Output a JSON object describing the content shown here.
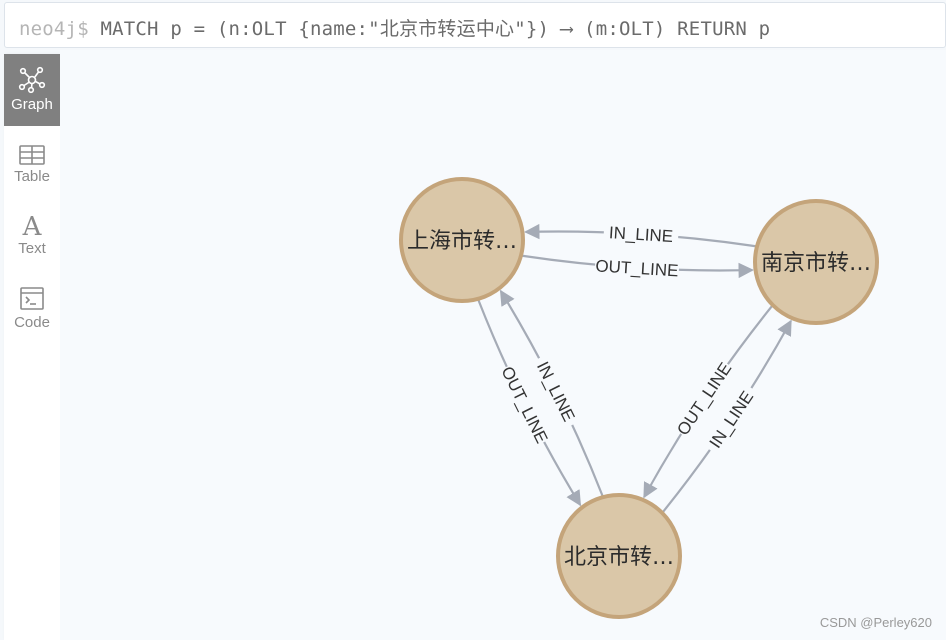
{
  "query": {
    "prompt": "neo4j$",
    "text": "MATCH p = (n:OLT {name:\"北京市转运中心\"}) ⟶ (m:OLT) RETURN p"
  },
  "sidebar": {
    "items": [
      {
        "label": "Graph",
        "icon": "graph-icon",
        "active": true
      },
      {
        "label": "Table",
        "icon": "table-icon",
        "active": false
      },
      {
        "label": "Text",
        "icon": "text-icon",
        "active": false
      },
      {
        "label": "Code",
        "icon": "code-icon",
        "active": false
      }
    ]
  },
  "graph": {
    "node_color": "#dac7a8",
    "node_border": "#c4a47a",
    "edge_color": "#a5abb6",
    "nodes": [
      {
        "id": "shanghai",
        "label": "上海市转…"
      },
      {
        "id": "nanjing",
        "label": "南京市转…"
      },
      {
        "id": "beijing",
        "label": "北京市转…"
      }
    ],
    "edges": [
      {
        "from": "shanghai",
        "to": "nanjing",
        "label": "OUT_LINE"
      },
      {
        "from": "nanjing",
        "to": "shanghai",
        "label": "IN_LINE"
      },
      {
        "from": "shanghai",
        "to": "beijing",
        "label": "OUT_LINE"
      },
      {
        "from": "beijing",
        "to": "shanghai",
        "label": "IN_LINE"
      },
      {
        "from": "beijing",
        "to": "nanjing",
        "label": "IN_LINE"
      },
      {
        "from": "nanjing",
        "to": "beijing",
        "label": "OUT_LINE"
      }
    ]
  },
  "watermark": "CSDN @Perley620"
}
